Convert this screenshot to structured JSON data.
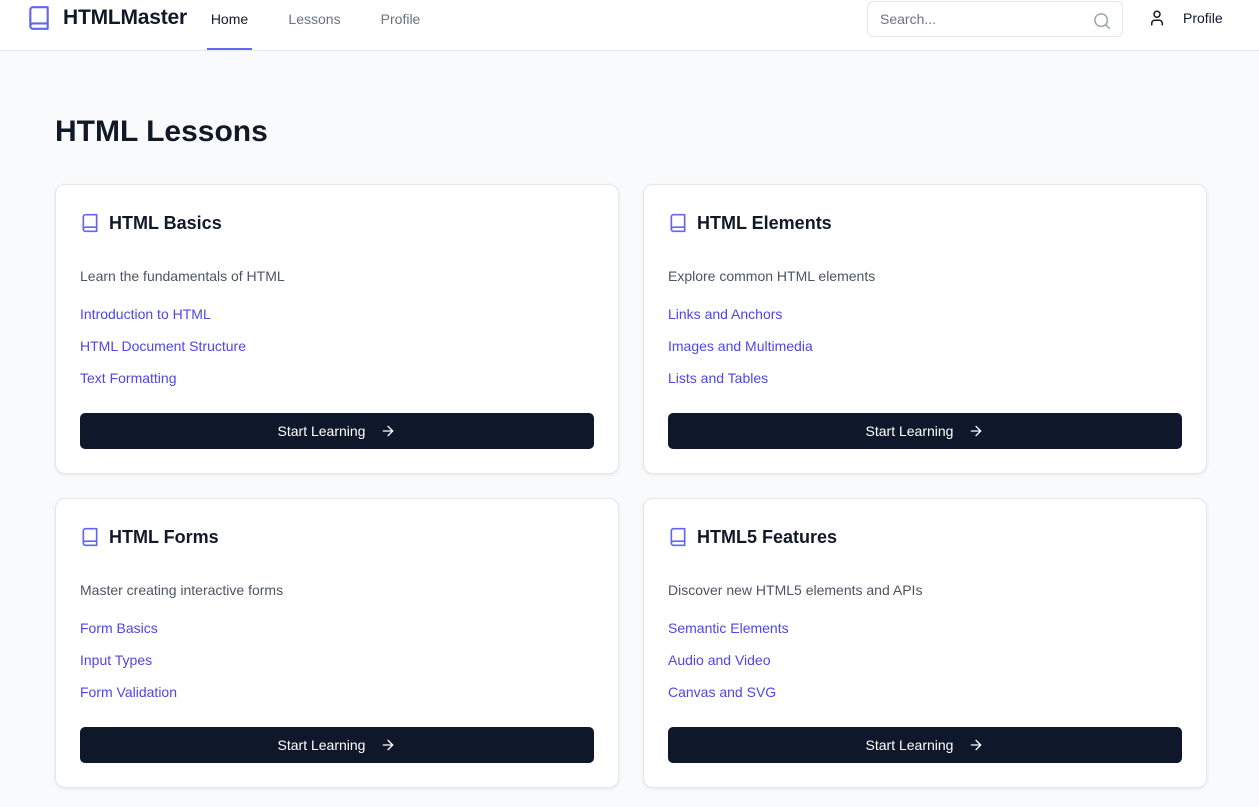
{
  "nav": {
    "brand": "HTMLMaster",
    "links": [
      {
        "label": "Home",
        "active": true
      },
      {
        "label": "Lessons",
        "active": false
      },
      {
        "label": "Profile",
        "active": false
      }
    ],
    "search_placeholder": "Search...",
    "profile_label": "Profile",
    "icons": {
      "brand": "book-icon",
      "search": "search-icon",
      "profile": "user-icon"
    }
  },
  "main": {
    "title": "HTML Lessons",
    "cards": [
      {
        "title": "HTML Basics",
        "description": "Learn the fundamentals of HTML",
        "links": [
          "Introduction to HTML",
          "HTML Document Structure",
          "Text Formatting"
        ],
        "button_label": "Start Learning"
      },
      {
        "title": "HTML Elements",
        "description": "Explore common HTML elements",
        "links": [
          "Links and Anchors",
          "Images and Multimedia",
          "Lists and Tables"
        ],
        "button_label": "Start Learning"
      },
      {
        "title": "HTML Forms",
        "description": "Master creating interactive forms",
        "links": [
          "Form Basics",
          "Input Types",
          "Form Validation"
        ],
        "button_label": "Start Learning"
      },
      {
        "title": "HTML5 Features",
        "description": "Discover new HTML5 elements and APIs",
        "links": [
          "Semantic Elements",
          "Audio and Video",
          "Canvas and SVG"
        ],
        "button_label": "Start Learning"
      }
    ]
  },
  "colors": {
    "accent": "#6366f1",
    "link": "#4f46e5",
    "button_bg": "#0f172a",
    "page_bg": "#f9fafb"
  }
}
